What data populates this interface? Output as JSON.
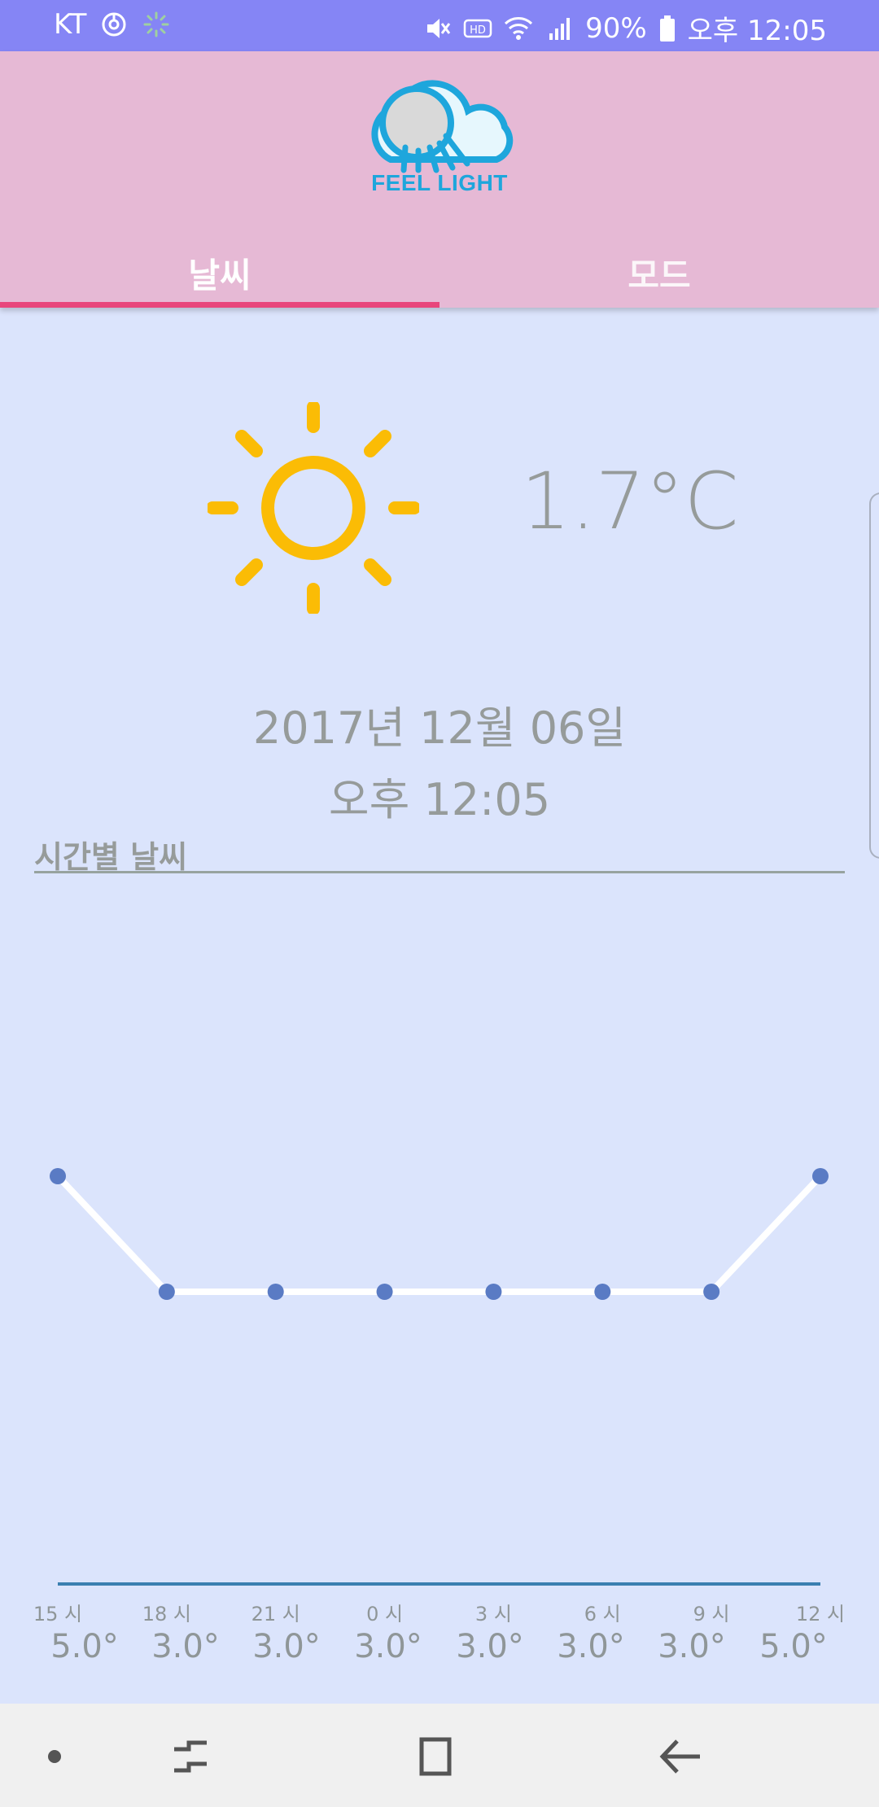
{
  "status_bar": {
    "carrier": "KT",
    "battery_percent": "90%",
    "time": "오후 12:05",
    "icons": [
      "sync-icon",
      "loading-icon",
      "mute-icon",
      "hd-icon",
      "wifi-icon",
      "signal-icon",
      "battery-icon"
    ]
  },
  "header": {
    "logo_text": "FEEL LIGHT",
    "tabs": [
      {
        "label": "날씨",
        "selected": true
      },
      {
        "label": "모드",
        "selected": false
      }
    ],
    "accent_color": "#e8467c",
    "background_color": "#e6b9d5"
  },
  "weather": {
    "icon": "sun-icon",
    "icon_color": "#fbbc05",
    "temperature": "1.7°C",
    "date": "2017년 12월 06일",
    "time": "오후 12:05"
  },
  "hourly": {
    "title": "시간별 날씨"
  },
  "chart_data": {
    "type": "line",
    "categories": [
      "15 시",
      "18 시",
      "21 시",
      "0 시",
      "3 시",
      "6 시",
      "9 시",
      "12 시"
    ],
    "values": [
      5.0,
      3.0,
      3.0,
      3.0,
      3.0,
      3.0,
      3.0,
      5.0
    ],
    "value_labels": [
      "5.0°",
      "3.0°",
      "3.0°",
      "3.0°",
      "3.0°",
      "3.0°",
      "3.0°",
      "5.0°"
    ],
    "ylim": [
      1,
      7
    ],
    "grid": false,
    "line_color": "#ffffff",
    "point_color": "#5a7bc4",
    "baseline_color": "#3a7fb0"
  },
  "nav_bar": {
    "buttons": [
      "recent-dot-icon",
      "recents-icon",
      "home-icon",
      "back-icon"
    ]
  }
}
